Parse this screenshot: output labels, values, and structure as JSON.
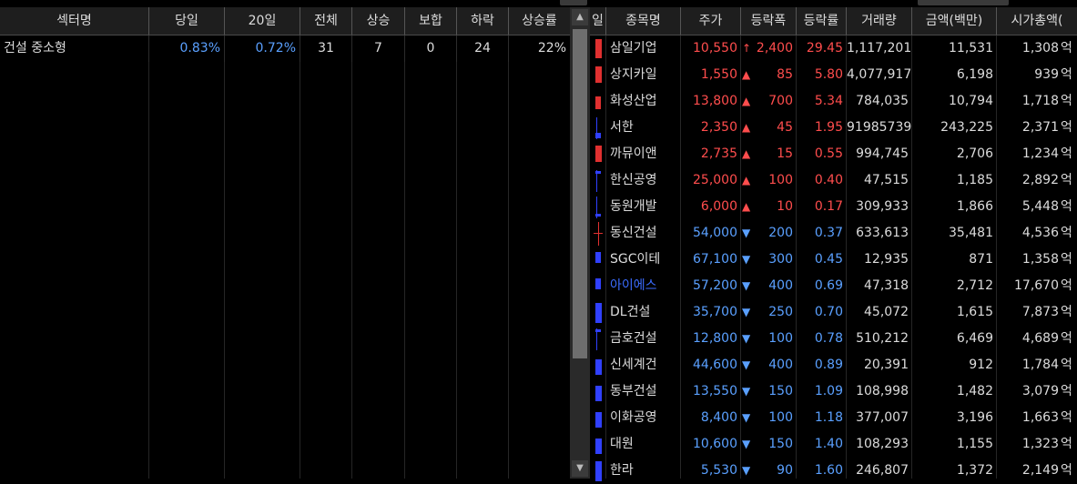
{
  "colors": {
    "up": "#ff4d4d",
    "down": "#5aa0ff",
    "red_bar": "#e03030",
    "blue_bar": "#3040ff"
  },
  "sector_table": {
    "headers": [
      "섹터명",
      "당일",
      "20일",
      "전체",
      "상승",
      "보합",
      "하락",
      "상승률"
    ],
    "rows": [
      {
        "name": "건설 중소형",
        "today": "0.83%",
        "d20": "0.72%",
        "total": "31",
        "up": "7",
        "flat": "0",
        "down": "24",
        "rate": "22%"
      }
    ]
  },
  "scrollbar": {
    "up_arrow": "▲",
    "down_arrow": "▼"
  },
  "stock_table": {
    "headers": [
      "일",
      "종목명",
      "주가",
      "등락폭",
      "등락률",
      "거래량",
      "금액(백만)",
      "시가총액("
    ],
    "rows": [
      {
        "dir": "up",
        "arrow": "↑",
        "name": "삼일기업",
        "price": "10,550",
        "chg": "2,400",
        "rate": "29.45",
        "vol": "1,117,201",
        "amt": "11,531",
        "cap": "1,308",
        "unit": "억",
        "candle": "red-full"
      },
      {
        "dir": "up",
        "arrow": "▲",
        "name": "상지카일",
        "price": "1,550",
        "chg": "85",
        "rate": "5.80",
        "vol": "4,077,917",
        "amt": "6,198",
        "cap": "939",
        "unit": "억",
        "candle": "red-tall"
      },
      {
        "dir": "up",
        "arrow": "▲",
        "name": "화성산업",
        "price": "13,800",
        "chg": "700",
        "rate": "5.34",
        "vol": "784,035",
        "amt": "10,794",
        "cap": "1,718",
        "unit": "억",
        "candle": "red-mid"
      },
      {
        "dir": "up",
        "arrow": "▲",
        "name": "서한",
        "price": "2,350",
        "chg": "45",
        "rate": "1.95",
        "vol": "91985739",
        "amt": "243,225",
        "cap": "2,371",
        "unit": "억",
        "candle": "blue-small"
      },
      {
        "dir": "up",
        "arrow": "▲",
        "name": "까뮤이앤",
        "price": "2,735",
        "chg": "15",
        "rate": "0.55",
        "vol": "994,745",
        "amt": "2,706",
        "cap": "1,234",
        "unit": "억",
        "candle": "red-tall"
      },
      {
        "dir": "up",
        "arrow": "▲",
        "name": "한신공영",
        "price": "25,000",
        "chg": "100",
        "rate": "0.40",
        "vol": "47,515",
        "amt": "1,185",
        "cap": "2,892",
        "unit": "억",
        "candle": "blue-line"
      },
      {
        "dir": "up",
        "arrow": "▲",
        "name": "동원개발",
        "price": "6,000",
        "chg": "10",
        "rate": "0.17",
        "vol": "309,933",
        "amt": "1,866",
        "cap": "5,448",
        "unit": "억",
        "candle": "blue-line2"
      },
      {
        "dir": "dn",
        "arrow": "▼",
        "name": "동신건설",
        "price": "54,000",
        "chg": "200",
        "rate": "0.37",
        "vol": "633,613",
        "amt": "35,481",
        "cap": "4,536",
        "unit": "억",
        "candle": "red-line"
      },
      {
        "dir": "dn",
        "arrow": "▼",
        "name": "SGC이테",
        "price": "67,100",
        "chg": "300",
        "rate": "0.45",
        "vol": "12,935",
        "amt": "871",
        "cap": "1,358",
        "unit": "억",
        "candle": "blue-mid"
      },
      {
        "dir": "dn",
        "arrow": "▼",
        "name": "아이에스",
        "price": "57,200",
        "chg": "400",
        "rate": "0.69",
        "vol": "47,318",
        "amt": "2,712",
        "cap": "17,670",
        "unit": "억",
        "candle": "blue-mid",
        "highlight": true
      },
      {
        "dir": "dn",
        "arrow": "▼",
        "name": "DL건설",
        "price": "35,700",
        "chg": "250",
        "rate": "0.70",
        "vol": "45,072",
        "amt": "1,615",
        "cap": "7,873",
        "unit": "억",
        "candle": "blue-full"
      },
      {
        "dir": "dn",
        "arrow": "▼",
        "name": "금호건설",
        "price": "12,800",
        "chg": "100",
        "rate": "0.78",
        "vol": "510,212",
        "amt": "6,469",
        "cap": "4,689",
        "unit": "억",
        "candle": "blue-line3"
      },
      {
        "dir": "dn",
        "arrow": "▼",
        "name": "신세계건",
        "price": "44,600",
        "chg": "400",
        "rate": "0.89",
        "vol": "20,391",
        "amt": "912",
        "cap": "1,784",
        "unit": "억",
        "candle": "blue-tall"
      },
      {
        "dir": "dn",
        "arrow": "▼",
        "name": "동부건설",
        "price": "13,550",
        "chg": "150",
        "rate": "1.09",
        "vol": "108,998",
        "amt": "1,482",
        "cap": "3,079",
        "unit": "억",
        "candle": "blue-tall"
      },
      {
        "dir": "dn",
        "arrow": "▼",
        "name": "이화공영",
        "price": "8,400",
        "chg": "100",
        "rate": "1.18",
        "vol": "377,007",
        "amt": "3,196",
        "cap": "1,663",
        "unit": "억",
        "candle": "blue-tall"
      },
      {
        "dir": "dn",
        "arrow": "▼",
        "name": "대원",
        "price": "10,600",
        "chg": "150",
        "rate": "1.40",
        "vol": "108,293",
        "amt": "1,155",
        "cap": "1,323",
        "unit": "억",
        "candle": "blue-tall"
      },
      {
        "dir": "dn",
        "arrow": "▼",
        "name": "한라",
        "price": "5,530",
        "chg": "90",
        "rate": "1.60",
        "vol": "246,807",
        "amt": "1,372",
        "cap": "2,149",
        "unit": "억",
        "candle": "blue-full"
      }
    ]
  }
}
